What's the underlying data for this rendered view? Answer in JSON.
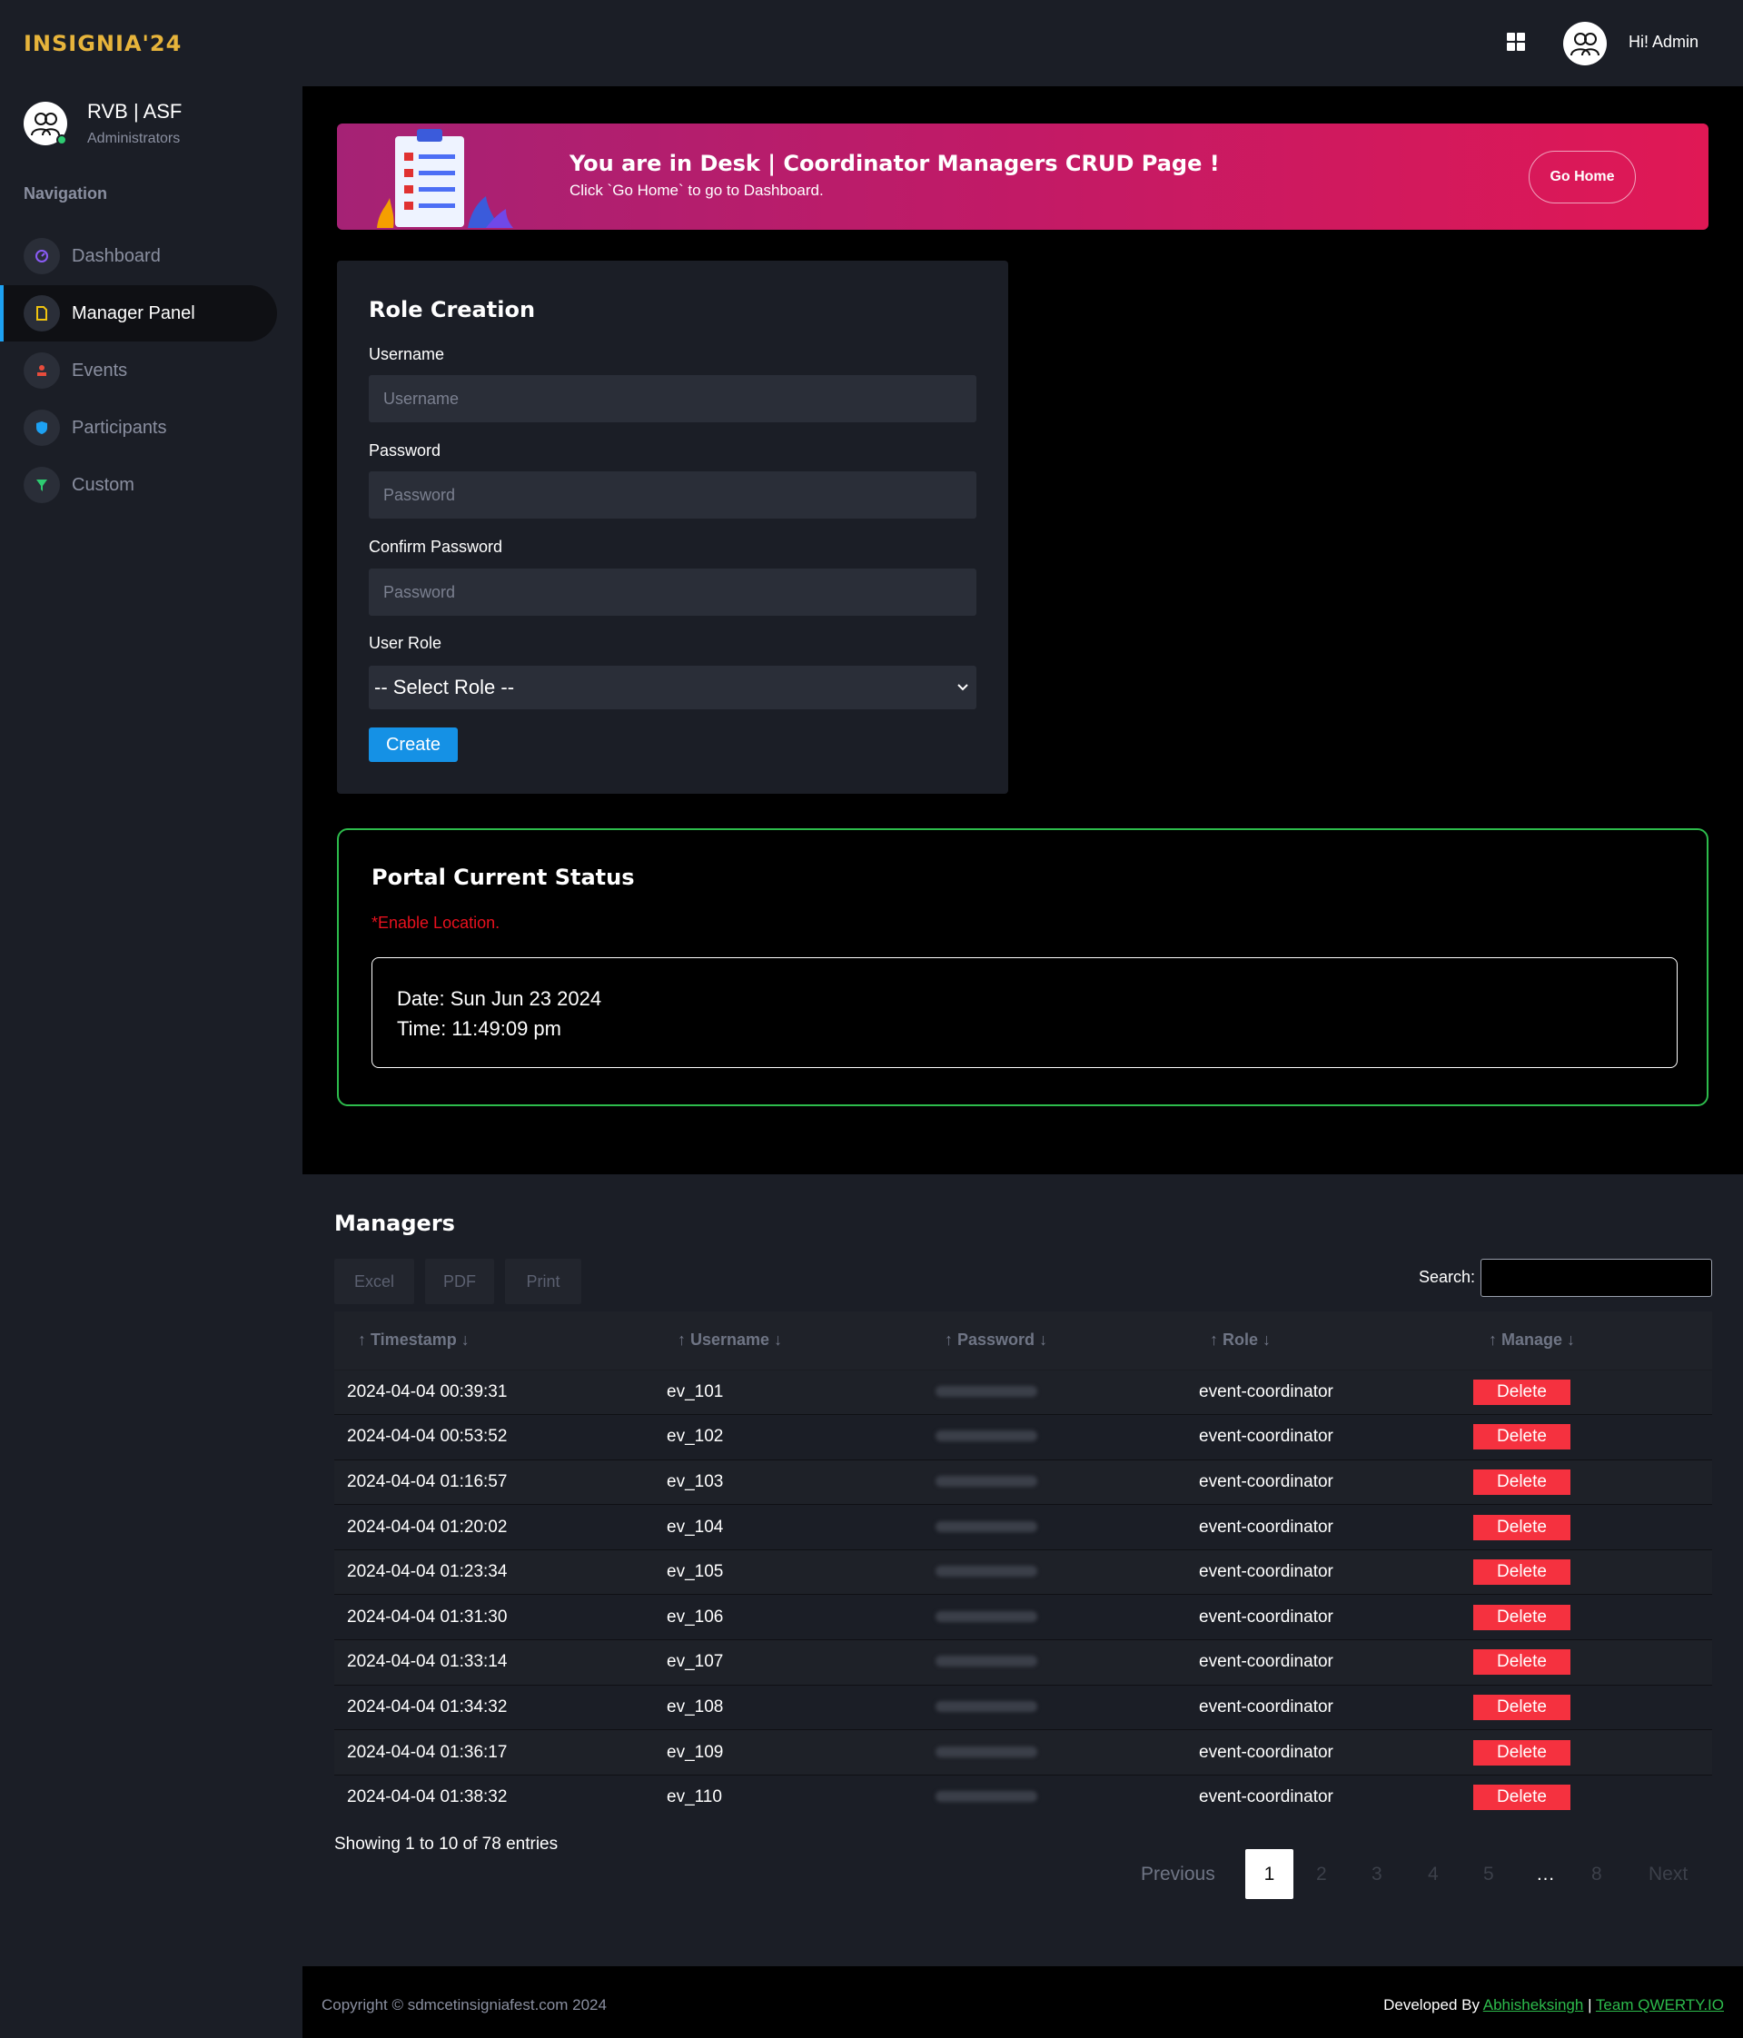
{
  "app": {
    "logo": "INSIGNIA'24"
  },
  "profile": {
    "name": "RVB | ASF",
    "role": "Administrators"
  },
  "sidebar": {
    "section_title": "Navigation",
    "items": [
      {
        "label": "Dashboard",
        "icon": "gauge-icon",
        "color": "#8b5cf6"
      },
      {
        "label": "Manager Panel",
        "icon": "file-icon",
        "color": "#f1c40f"
      },
      {
        "label": "Events",
        "icon": "flag-icon",
        "color": "#e74c3c"
      },
      {
        "label": "Participants",
        "icon": "shield-icon",
        "color": "#1da1f2"
      },
      {
        "label": "Custom",
        "icon": "funnel-icon",
        "color": "#2ecc71"
      }
    ]
  },
  "header": {
    "greeting": "Hi! Admin"
  },
  "banner": {
    "title": "You are in Desk | Coordinator Managers CRUD Page !",
    "subtitle": "Click `Go Home` to go to Dashboard.",
    "button": "Go Home"
  },
  "role_form": {
    "title": "Role Creation",
    "username_label": "Username",
    "username_placeholder": "Username",
    "password_label": "Password",
    "password_placeholder": "Password",
    "confirm_label": "Confirm Password",
    "confirm_placeholder": "Password",
    "role_label": "User Role",
    "role_selected": "-- Select Role --",
    "create_button": "Create"
  },
  "portal_status": {
    "title": "Portal Current Status",
    "warning": "*Enable Location.",
    "date": "Date: Sun Jun 23 2024",
    "time": "Time: 11:49:09 pm"
  },
  "managers": {
    "title": "Managers",
    "export_buttons": [
      "Excel",
      "PDF",
      "Print"
    ],
    "search_label": "Search:",
    "columns": [
      "Timestamp",
      "Username",
      "Password",
      "Role",
      "Manage"
    ],
    "delete_label": "Delete",
    "rows": [
      {
        "timestamp": "2024-04-04 00:39:31",
        "username": "ev_101",
        "role": "event-coordinator"
      },
      {
        "timestamp": "2024-04-04 00:53:52",
        "username": "ev_102",
        "role": "event-coordinator"
      },
      {
        "timestamp": "2024-04-04 01:16:57",
        "username": "ev_103",
        "role": "event-coordinator"
      },
      {
        "timestamp": "2024-04-04 01:20:02",
        "username": "ev_104",
        "role": "event-coordinator"
      },
      {
        "timestamp": "2024-04-04 01:23:34",
        "username": "ev_105",
        "role": "event-coordinator"
      },
      {
        "timestamp": "2024-04-04 01:31:30",
        "username": "ev_106",
        "role": "event-coordinator"
      },
      {
        "timestamp": "2024-04-04 01:33:14",
        "username": "ev_107",
        "role": "event-coordinator"
      },
      {
        "timestamp": "2024-04-04 01:34:32",
        "username": "ev_108",
        "role": "event-coordinator"
      },
      {
        "timestamp": "2024-04-04 01:36:17",
        "username": "ev_109",
        "role": "event-coordinator"
      },
      {
        "timestamp": "2024-04-04 01:38:32",
        "username": "ev_110",
        "role": "event-coordinator"
      }
    ],
    "showing": "Showing 1 to 10 of 78 entries",
    "pagination": {
      "previous": "Previous",
      "pages": [
        "1",
        "2",
        "3",
        "4",
        "5",
        "…",
        "8"
      ],
      "current": "1",
      "next": "Next"
    }
  },
  "footer": {
    "copyright": "Copyright © sdmcetinsigniafest.com 2024",
    "developed_by": "Developed By",
    "developer": "Abhisheksingh",
    "separator": "|",
    "team": "Team QWERTY.IO"
  }
}
